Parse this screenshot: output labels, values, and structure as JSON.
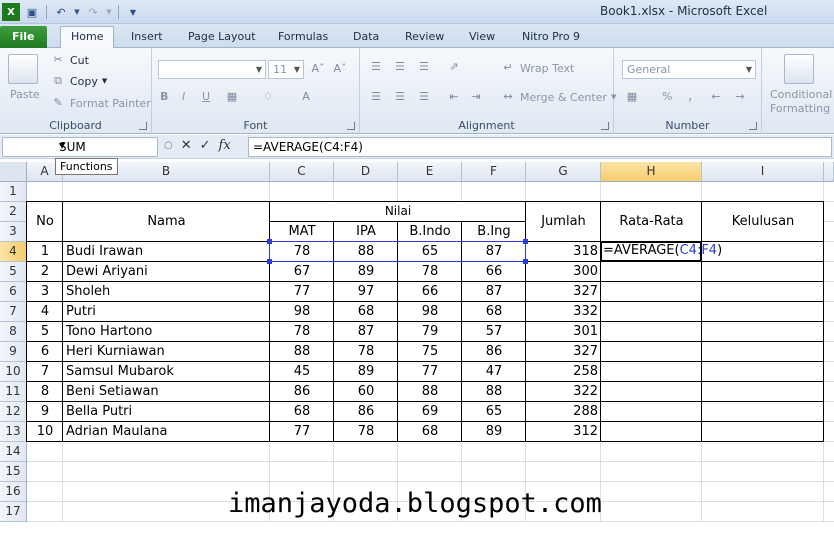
{
  "window": {
    "title": "Book1.xlsx  -  Microsoft Excel"
  },
  "quick_access": {
    "icons": [
      "excel-icon",
      "save-icon",
      "undo-icon",
      "redo-icon",
      "customize-icon"
    ]
  },
  "tabs": [
    "File",
    "Home",
    "Insert",
    "Page Layout",
    "Formulas",
    "Data",
    "Review",
    "View",
    "Nitro Pro 9"
  ],
  "ribbon": {
    "clipboard": {
      "label": "Clipboard",
      "paste": "Paste",
      "cut": "Cut",
      "copy": "Copy",
      "format_painter": "Format Painter"
    },
    "font": {
      "label": "Font",
      "size": "11",
      "bold": "B",
      "italic": "I",
      "underline": "U"
    },
    "alignment": {
      "label": "Alignment",
      "wrap_text": "Wrap Text",
      "merge_center": "Merge & Center"
    },
    "number": {
      "label": "Number",
      "format": "General",
      "percent": "%",
      "comma": ","
    },
    "styles": {
      "conditional": "Conditional",
      "formatting": "Formatting"
    }
  },
  "formula_bar": {
    "name_box": "SUM",
    "cancel": "✕",
    "enter": "✓",
    "fx": "fx",
    "formula": "=AVERAGE(C4:F4)",
    "tooltip": "Functions"
  },
  "grid": {
    "columns": [
      "A",
      "B",
      "C",
      "D",
      "E",
      "F",
      "G",
      "H",
      "I"
    ],
    "rows": [
      "1",
      "2",
      "3",
      "4",
      "5",
      "6",
      "7",
      "8",
      "9",
      "10",
      "11",
      "12",
      "13",
      "14",
      "15",
      "16",
      "17"
    ],
    "selected_column": "H",
    "selected_row": "4",
    "headers": {
      "no": "No",
      "nama": "Nama",
      "nilai": "Nilai",
      "mat": "MAT",
      "ipa": "IPA",
      "bindo": "B.Indo",
      "bing": "B.Ing",
      "jumlah": "Jumlah",
      "rata_rata": "Rata-Rata",
      "kelulusan": "Kelulusan"
    },
    "records": [
      {
        "no": "1",
        "nama": "Budi Irawan",
        "mat": "78",
        "ipa": "88",
        "bindo": "65",
        "bing": "87",
        "jumlah": "318"
      },
      {
        "no": "2",
        "nama": "Dewi Ariyani",
        "mat": "67",
        "ipa": "89",
        "bindo": "78",
        "bing": "66",
        "jumlah": "300"
      },
      {
        "no": "3",
        "nama": "Sholeh",
        "mat": "77",
        "ipa": "97",
        "bindo": "66",
        "bing": "87",
        "jumlah": "327"
      },
      {
        "no": "4",
        "nama": "Putri",
        "mat": "98",
        "ipa": "68",
        "bindo": "98",
        "bing": "68",
        "jumlah": "332"
      },
      {
        "no": "5",
        "nama": "Tono Hartono",
        "mat": "78",
        "ipa": "87",
        "bindo": "79",
        "bing": "57",
        "jumlah": "301"
      },
      {
        "no": "6",
        "nama": "Heri Kurniawan",
        "mat": "88",
        "ipa": "78",
        "bindo": "75",
        "bing": "86",
        "jumlah": "327"
      },
      {
        "no": "7",
        "nama": "Samsul Mubarok",
        "mat": "45",
        "ipa": "89",
        "bindo": "77",
        "bing": "47",
        "jumlah": "258"
      },
      {
        "no": "8",
        "nama": "Beni Setiawan",
        "mat": "86",
        "ipa": "60",
        "bindo": "88",
        "bing": "88",
        "jumlah": "322"
      },
      {
        "no": "9",
        "nama": "Bella Putri",
        "mat": "68",
        "ipa": "86",
        "bindo": "69",
        "bing": "65",
        "jumlah": "288"
      },
      {
        "no": "10",
        "nama": "Adrian Maulana",
        "mat": "77",
        "ipa": "78",
        "bindo": "68",
        "bing": "89",
        "jumlah": "312"
      }
    ],
    "editing_cell": {
      "prefix": "=AVERAGE(",
      "ref": "C4:F4",
      "suffix": ")"
    }
  },
  "watermark": "imanjayoda.blogspot.com",
  "colors": {
    "file_tab": "#2a8a2a",
    "selection_header": "#f8cd6c",
    "reference": "#2b3dd6"
  }
}
